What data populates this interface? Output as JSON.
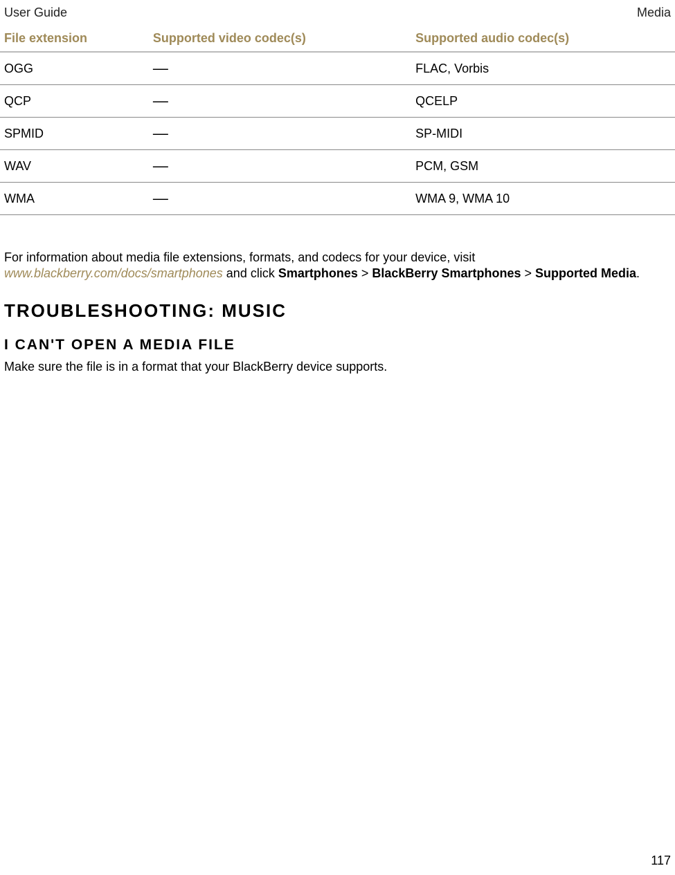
{
  "header": {
    "left": "User Guide",
    "right": "Media"
  },
  "table": {
    "headers": [
      "File extension",
      "Supported video codec(s)",
      "Supported audio codec(s)"
    ],
    "rows": [
      {
        "ext": "OGG",
        "video": "—",
        "audio": "FLAC, Vorbis"
      },
      {
        "ext": "QCP",
        "video": "—",
        "audio": "QCELP"
      },
      {
        "ext": "SPMID",
        "video": "—",
        "audio": "SP-MIDI"
      },
      {
        "ext": "WAV",
        "video": "—",
        "audio": "PCM, GSM"
      },
      {
        "ext": "WMA",
        "video": "—",
        "audio": "WMA 9, WMA 10"
      }
    ]
  },
  "info": {
    "pre": "For information about media file extensions, formats, and codecs for your device, visit ",
    "link": "www.blackberry.com/docs/smartphones",
    "mid1": " and click ",
    "b1": "Smartphones",
    "sep": " > ",
    "b2": "BlackBerry Smartphones",
    "b3": "Supported Media",
    "period": "."
  },
  "headings": {
    "main": "Troubleshooting: Music",
    "sub": "I can't open a media file"
  },
  "body": {
    "p1": "Make sure the file is in a format that your BlackBerry device supports."
  },
  "page_number": "117"
}
